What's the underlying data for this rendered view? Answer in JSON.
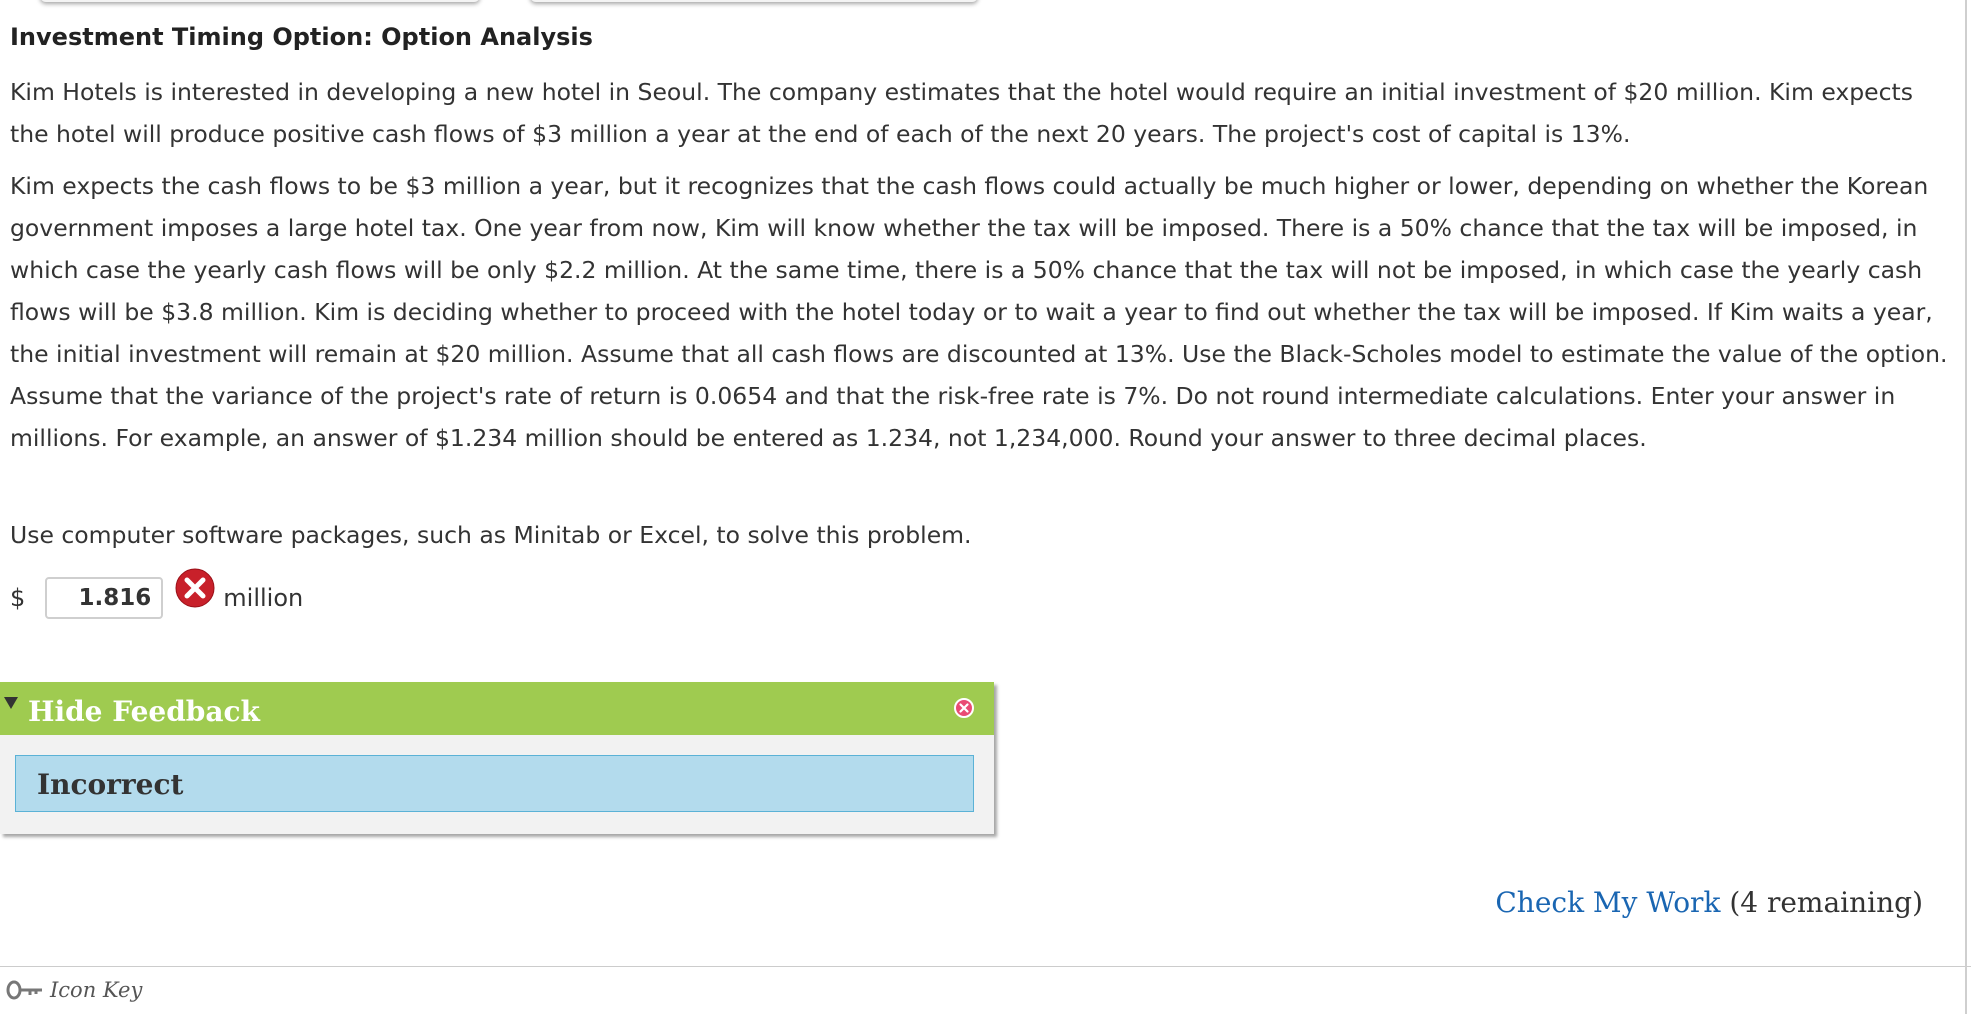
{
  "problem": {
    "title": "Investment Timing Option: Option Analysis",
    "paragraphs": [
      "Kim Hotels is interested in developing a new hotel in Seoul. The company estimates that the hotel would require an initial investment of $20 million. Kim expects the hotel will produce positive cash flows of $3 million a year at the end of each of the next 20 years. The project's cost of capital is 13%.",
      "Kim expects the cash flows to be $3 million a year, but it recognizes that the cash flows could actually be much higher or lower, depending on whether the Korean government imposes a large hotel tax. One year from now, Kim will know whether the tax will be imposed. There is a 50% chance that the tax will be imposed, in which case the yearly cash flows will be only $2.2 million. At the same time, there is a 50% chance that the tax will not be imposed, in which case the yearly cash flows will be $3.8 million. Kim is deciding whether to proceed with the hotel today or to wait a year to find out whether the tax will be imposed. If Kim waits a year, the initial investment will remain at $20 million. Assume that all cash flows are discounted at 13%. Use the Black-Scholes model to estimate the value of the option. Assume that the variance of the project's rate of return is 0.0654 and that the risk-free rate is 7%. Do not round intermediate calculations. Enter your answer in millions. For example, an answer of $1.234 million should be entered as 1.234, not 1,234,000. Round your answer to three decimal places.",
      "Use computer software packages, such as Minitab or Excel, to solve this problem."
    ]
  },
  "answer": {
    "currency_symbol": "$",
    "value": "1.816",
    "unit": "million",
    "status_icon": "incorrect-x-icon"
  },
  "feedback": {
    "toggle_label": "Hide Feedback",
    "result": "Incorrect",
    "header_color": "#9fcb50",
    "body_color": "#b3dbed"
  },
  "check_work": {
    "link_label": "Check My Work",
    "remaining": "(4 remaining)",
    "link_color": "#1a66b2"
  },
  "footer": {
    "icon_key_label": "Icon Key",
    "icon": "key-icon"
  }
}
